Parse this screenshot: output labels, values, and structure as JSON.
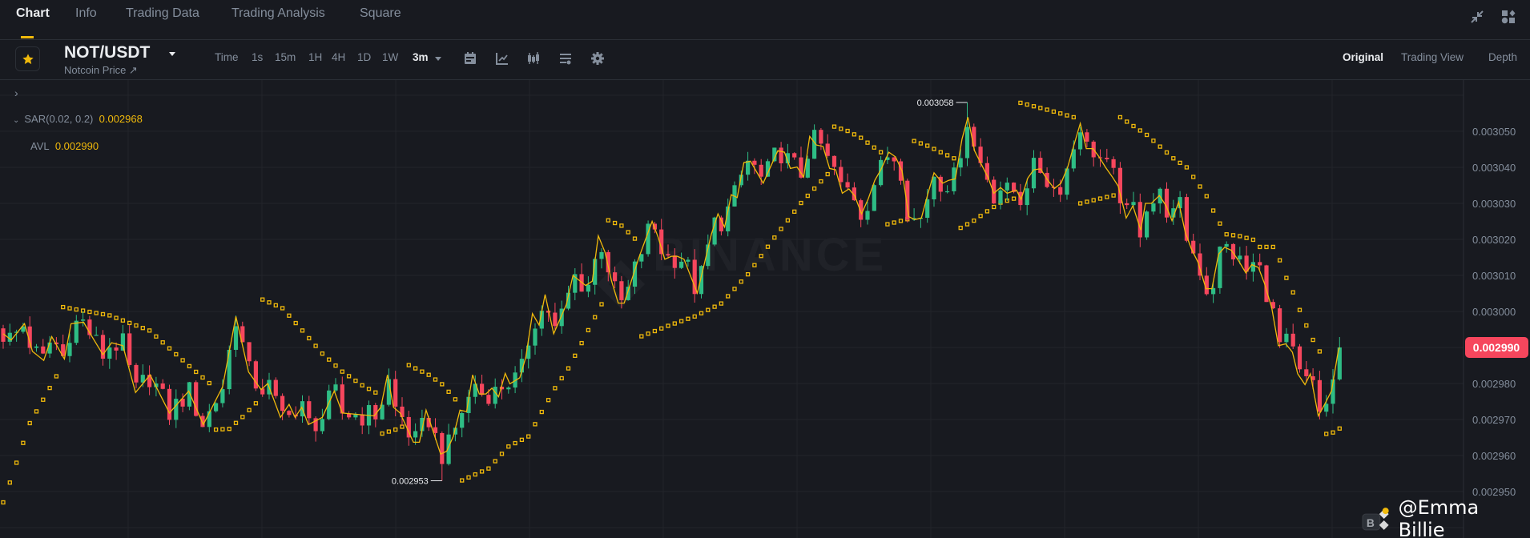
{
  "tabs": [
    {
      "label": "Chart",
      "active": true
    },
    {
      "label": "Info"
    },
    {
      "label": "Trading Data"
    },
    {
      "label": "Trading Analysis"
    },
    {
      "label": "Square"
    }
  ],
  "header": {
    "pair": "NOT/USDT",
    "subtitle": "Notcoin Price ↗",
    "intervals": [
      "Time",
      "1s",
      "15m",
      "1H",
      "4H",
      "1D",
      "1W"
    ],
    "active_interval": "3m",
    "views": [
      "Original",
      "Trading View",
      "Depth"
    ],
    "active_view": "Original"
  },
  "legend": {
    "sar_label": "SAR(0.02, 0.2)",
    "sar_value": "0.002968",
    "avl_label": "AVL",
    "avl_value": "0.002990"
  },
  "colors": {
    "up": "#2ebd85",
    "down": "#f6465d",
    "accent": "#f0b90b",
    "avl": "#f0b90b"
  },
  "watermark": "BINANCE",
  "credit": "@Emma Billie",
  "chart": {
    "price_unit": 1e-06,
    "axis_labels": [
      "0.003050",
      "0.003040",
      "0.003030",
      "0.003020",
      "0.003010",
      "0.003000",
      "0.002990",
      "0.002980",
      "0.002970",
      "0.002960",
      "0.002950"
    ],
    "last_price": "0.002990",
    "last_price_value": 2990,
    "high_marker": {
      "label": "0.003058",
      "index": 145,
      "price": 3058
    },
    "low_marker": {
      "label": "0.002953",
      "index": 66,
      "price": 2953
    },
    "candle_count": 202,
    "avl_path": [
      [
        0,
        2993.8
      ],
      [
        1.2,
        2992.1
      ],
      [
        3.2,
        2996.6
      ],
      [
        4.4,
        2988.9
      ],
      [
        6.1,
        2986.4
      ],
      [
        7.3,
        2993
      ],
      [
        9.2,
        2986.8
      ],
      [
        10.2,
        2996.6
      ],
      [
        12.1,
        2997
      ],
      [
        13.1,
        2993.8
      ],
      [
        15,
        2988
      ],
      [
        16.3,
        2991.3
      ],
      [
        18,
        2990.5
      ],
      [
        19.9,
        2977.5
      ],
      [
        22.1,
        2982.4
      ],
      [
        25,
        2971.8
      ],
      [
        27.9,
        2977.9
      ],
      [
        30.1,
        2968.6
      ],
      [
        33,
        2979.1
      ],
      [
        35,
        2998.6
      ],
      [
        36.9,
        2983.2
      ],
      [
        38.8,
        2978.3
      ],
      [
        39.8,
        2980
      ],
      [
        41.7,
        2970.6
      ],
      [
        43,
        2974.2
      ],
      [
        43.9,
        2970.6
      ],
      [
        44.9,
        2973.4
      ],
      [
        45.9,
        2968.6
      ],
      [
        48,
        2970.6
      ],
      [
        49.8,
        2977.9
      ],
      [
        51,
        2971.8
      ],
      [
        55.8,
        2971
      ],
      [
        56.8,
        2973.4
      ],
      [
        57.8,
        2982.4
      ],
      [
        58.7,
        2973.4
      ],
      [
        59.7,
        2971.8
      ],
      [
        61.7,
        2963.7
      ],
      [
        62.6,
        2963.7
      ],
      [
        63.6,
        2972.6
      ],
      [
        65.8,
        2960.4
      ],
      [
        66.7,
        2961.2
      ],
      [
        67.7,
        2965.3
      ],
      [
        68.7,
        2972.6
      ],
      [
        69.7,
        2972.2
      ],
      [
        70.6,
        2982.4
      ],
      [
        71.6,
        2977.1
      ],
      [
        72.6,
        2977.1
      ],
      [
        73.5,
        2978.7
      ],
      [
        74.5,
        2976.3
      ],
      [
        75.5,
        2982.8
      ],
      [
        76.2,
        2979.9
      ],
      [
        77.7,
        2981.6
      ],
      [
        78.6,
        2987.3
      ],
      [
        79.6,
        2999.4
      ],
      [
        80.6,
        2996.2
      ],
      [
        81.5,
        3004.7
      ],
      [
        82.8,
        2993.8
      ],
      [
        84.7,
        3001.9
      ],
      [
        85.7,
        3010
      ],
      [
        87.6,
        3007.2
      ],
      [
        88.6,
        3008.4
      ],
      [
        89.5,
        3021
      ],
      [
        90.5,
        3016.5
      ],
      [
        91.5,
        3008.4
      ],
      [
        92.5,
        3002.3
      ],
      [
        93.4,
        3002.3
      ],
      [
        95.6,
        3014.9
      ],
      [
        97.6,
        3025
      ],
      [
        98.5,
        3020.6
      ],
      [
        99.5,
        3014.5
      ],
      [
        100.5,
        3015.3
      ],
      [
        101.4,
        3015.3
      ],
      [
        102.4,
        3014.5
      ],
      [
        104.4,
        3005.1
      ],
      [
        106.5,
        3021.4
      ],
      [
        107.5,
        3027.1
      ],
      [
        108.5,
        3023.4
      ],
      [
        109.5,
        3032.4
      ],
      [
        110.4,
        3031.6
      ],
      [
        111.4,
        3041.3
      ],
      [
        112.4,
        3041.7
      ],
      [
        114.3,
        3035.6
      ],
      [
        116.5,
        3044.6
      ],
      [
        117.5,
        3044.2
      ],
      [
        118.4,
        3039.7
      ],
      [
        119.4,
        3040.1
      ],
      [
        120.4,
        3037.3
      ],
      [
        121.3,
        3048.6
      ],
      [
        122.3,
        3046.2
      ],
      [
        123.3,
        3045.8
      ],
      [
        124.3,
        3039.7
      ],
      [
        125.2,
        3039.3
      ],
      [
        126.2,
        3032.8
      ],
      [
        127.2,
        3034
      ],
      [
        128.1,
        3032
      ],
      [
        129.1,
        3027.1
      ],
      [
        130.1,
        3031.2
      ],
      [
        131.1,
        3036.4
      ],
      [
        132,
        3039.3
      ],
      [
        133.2,
        3044.2
      ],
      [
        134.2,
        3042.9
      ],
      [
        135.2,
        3038.9
      ],
      [
        136.2,
        3026.3
      ],
      [
        137.1,
        3025.5
      ],
      [
        138.1,
        3025.9
      ],
      [
        139.1,
        3032.8
      ],
      [
        140,
        3038.5
      ],
      [
        141.3,
        3035.6
      ],
      [
        142.2,
        3036.4
      ],
      [
        143.2,
        3036.8
      ],
      [
        144.2,
        3047.8
      ],
      [
        145.1,
        3053.9
      ],
      [
        146.1,
        3044.6
      ],
      [
        147.1,
        3040.9
      ],
      [
        148.1,
        3037.3
      ],
      [
        149,
        3032.8
      ],
      [
        150,
        3034.4
      ],
      [
        151,
        3032.8
      ],
      [
        152.4,
        3033.7
      ],
      [
        153.1,
        3031.1
      ],
      [
        154.1,
        3037
      ],
      [
        155,
        3039.3
      ],
      [
        156,
        3039.6
      ],
      [
        157,
        3036.7
      ],
      [
        158.1,
        3034.1
      ],
      [
        159.1,
        3035.6
      ],
      [
        160.1,
        3040
      ],
      [
        161,
        3045.9
      ],
      [
        162,
        3052.2
      ],
      [
        162.9,
        3045.2
      ],
      [
        163.9,
        3045.2
      ],
      [
        164.8,
        3043
      ],
      [
        165.8,
        3040
      ],
      [
        166.8,
        3037.4
      ],
      [
        167.7,
        3034.8
      ],
      [
        168.9,
        3025.9
      ],
      [
        169.9,
        3029.3
      ],
      [
        171.1,
        3022.6
      ],
      [
        171.8,
        3030
      ],
      [
        172.7,
        3030
      ],
      [
        173.9,
        3032.2
      ],
      [
        174.9,
        3029.3
      ],
      [
        175.8,
        3025.2
      ],
      [
        176.8,
        3030.4
      ],
      [
        177.8,
        3021.9
      ],
      [
        178.7,
        3017.4
      ],
      [
        179.7,
        3013.7
      ],
      [
        180.9,
        3006.3
      ],
      [
        181.8,
        3006.3
      ],
      [
        182.8,
        3015.9
      ],
      [
        183.7,
        3017.8
      ],
      [
        184.7,
        3017
      ],
      [
        185.7,
        3014.4
      ],
      [
        186.9,
        3010.7
      ],
      [
        187.8,
        3013
      ],
      [
        188.8,
        3012.2
      ],
      [
        189.7,
        3007.8
      ],
      [
        190.8,
        3001
      ],
      [
        191.8,
        2990.5
      ],
      [
        192.9,
        2991
      ],
      [
        193.9,
        2988.7
      ],
      [
        194.7,
        2982.7
      ],
      [
        195.8,
        2979.7
      ],
      [
        196.6,
        2982.7
      ],
      [
        197.8,
        2971
      ],
      [
        198.7,
        2974
      ],
      [
        199.8,
        2978
      ],
      [
        200.8,
        2989
      ],
      [
        201,
        2990
      ]
    ],
    "sar_segments": [
      [
        [
          0,
          2947
        ],
        [
          4,
          2969
        ],
        [
          8,
          2982
        ]
      ],
      [
        [
          9,
          3001.2
        ],
        [
          16,
          2998.9
        ],
        [
          22,
          2994.7
        ],
        [
          28,
          2984.8
        ],
        [
          31,
          2980.1
        ]
      ],
      [
        [
          32,
          2967.2
        ],
        [
          34,
          2967.4
        ],
        [
          36,
          2970.7
        ],
        [
          38,
          2974.5
        ]
      ],
      [
        [
          39,
          3003.3
        ],
        [
          42,
          3000.9
        ],
        [
          45,
          2994.7
        ],
        [
          48,
          2988.3
        ],
        [
          51,
          2983.3
        ],
        [
          54,
          2979.5
        ],
        [
          56,
          2977.5
        ]
      ],
      [
        [
          57,
          2966.1
        ],
        [
          59,
          2967.2
        ],
        [
          60,
          2968
        ]
      ],
      [
        [
          61,
          2985.1
        ],
        [
          64,
          2982.4
        ],
        [
          66,
          2979.8
        ],
        [
          68,
          2975.6
        ]
      ],
      [
        [
          69,
          2953.1
        ],
        [
          73,
          2956.4
        ],
        [
          76,
          2962.5
        ],
        [
          79,
          2965.3
        ],
        [
          81,
          2972.1
        ],
        [
          83,
          2978.7
        ],
        [
          85,
          2984.2
        ],
        [
          87,
          2991.2
        ],
        [
          90,
          3002
        ]
      ],
      [
        [
          91,
          3025.3
        ],
        [
          93,
          3023.8
        ],
        [
          95,
          3020.2
        ]
      ],
      [
        [
          96,
          2993.1
        ],
        [
          100,
          2996
        ],
        [
          104,
          2998.6
        ],
        [
          108,
          3002.2
        ],
        [
          112,
          3010.3
        ],
        [
          116,
          3020.5
        ],
        [
          120,
          3030.1
        ],
        [
          124,
          3038.1
        ]
      ],
      [
        [
          125,
          3051.3
        ],
        [
          127,
          3050.1
        ],
        [
          129,
          3048.2
        ],
        [
          131,
          3045.5
        ],
        [
          132,
          3044.2
        ]
      ],
      [
        [
          133,
          3024.2
        ],
        [
          136,
          3025.6
        ]
      ],
      [
        [
          137,
          3047.3
        ],
        [
          139,
          3046
        ],
        [
          141,
          3044.2
        ],
        [
          143,
          3042.5
        ]
      ],
      [
        [
          144,
          3023.2
        ],
        [
          146,
          3025.2
        ],
        [
          148,
          3027.8
        ],
        [
          150,
          3030.2
        ],
        [
          152,
          3031.3
        ]
      ],
      [
        [
          153,
          3057.9
        ],
        [
          157,
          3056
        ],
        [
          161,
          3053.9
        ]
      ],
      [
        [
          162,
          3030
        ],
        [
          167,
          3032.2
        ]
      ],
      [
        [
          168,
          3053.9
        ],
        [
          172,
          3049
        ],
        [
          176,
          3042.5
        ],
        [
          178,
          3040
        ],
        [
          181,
          3032
        ],
        [
          182,
          3028
        ],
        [
          183,
          3024.4
        ],
        [
          184,
          3021.4
        ],
        [
          186,
          3020.9
        ],
        [
          188,
          3019.9
        ],
        [
          189,
          3017.9
        ],
        [
          191,
          3017.9
        ],
        [
          192,
          3014.2
        ],
        [
          193,
          3009.3
        ],
        [
          194,
          3005.3
        ],
        [
          195,
          3000.4
        ],
        [
          196,
          2996.1
        ],
        [
          197,
          2992.1
        ],
        [
          198,
          2988.9
        ]
      ],
      [
        [
          199,
          2966
        ],
        [
          200,
          2966.4
        ],
        [
          201,
          2967.5
        ]
      ]
    ]
  }
}
